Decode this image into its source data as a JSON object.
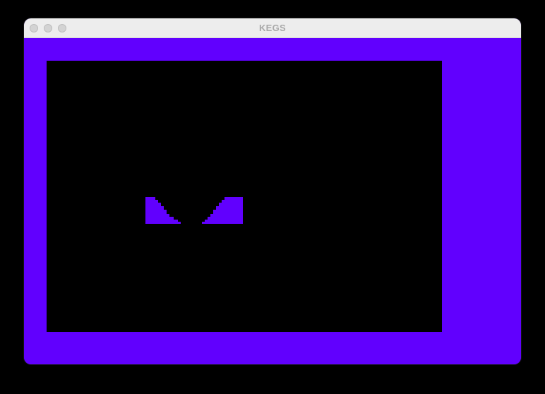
{
  "window": {
    "title": "KEGS"
  },
  "colors": {
    "border": "#6100FE",
    "screen": "#000000",
    "titlebar": "#EDEDED",
    "title_text": "#A9A9A9"
  },
  "titlebar": {
    "buttons": [
      "close-button",
      "minimize-button",
      "zoom-button"
    ]
  }
}
